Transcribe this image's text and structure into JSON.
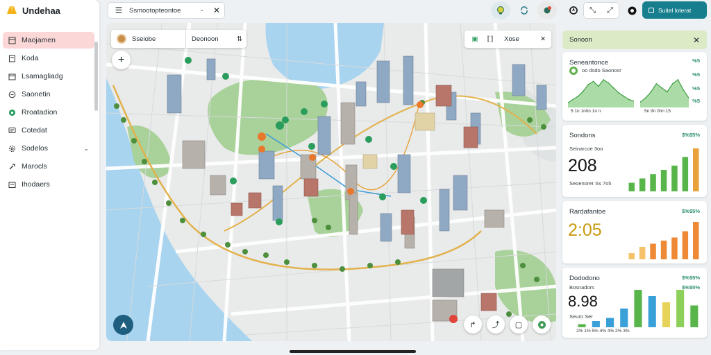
{
  "app": {
    "title": "Undehaa"
  },
  "sidebar": {
    "items": [
      {
        "label": "Maojamen",
        "icon": "grid-icon",
        "active": true
      },
      {
        "label": "Koda",
        "icon": "doc-icon"
      },
      {
        "label": "Lsamagliadg",
        "icon": "calendar-icon"
      },
      {
        "label": "Saonetin",
        "icon": "circle-icon"
      },
      {
        "label": "Rroatadion",
        "icon": "pin-icon"
      },
      {
        "label": "Cotedat",
        "icon": "chat-icon"
      },
      {
        "label": "Sodelos",
        "icon": "gear-icon",
        "chevron": "⌄"
      },
      {
        "label": "Marocls",
        "icon": "tool-icon"
      },
      {
        "label": "Ihodaers",
        "icon": "folder-icon"
      }
    ]
  },
  "topbar": {
    "search_value": "Ssmootopteontoe",
    "dash": "-",
    "primary_label": "Suitel loterat"
  },
  "map": {
    "route": {
      "from": "Sseiobe",
      "to": "Deonoon"
    },
    "tools": {
      "label": "Xose"
    }
  },
  "panel": {
    "title": "Sonoon",
    "cards": [
      {
        "title": "Seneantonce",
        "legend": "oo dsdo Saonosr",
        "tag_a": "%5",
        "tag_b": "%5",
        "tag_c": "%5",
        "tag_d": "%5",
        "xaxis": "5 1n 1n0n 1n n",
        "xaxis2": "5n 9n 0hn 15"
      },
      {
        "title": "Sondons",
        "tag": "$%$5%",
        "subtitle": "Seinarcoe 3oo",
        "value": "208",
        "foot": "Seoenorer Ss 7o5"
      },
      {
        "title": "Rardafantoe",
        "tag": "$%$5%",
        "value": "2:05"
      },
      {
        "title": "Dododono",
        "tag": "$%$5%",
        "value": "8.98",
        "sub_a": "Bosnadors",
        "sub_b": "Seuro Ser",
        "xaxis": "2% 1% 5% 4% 4% 2% 3%"
      }
    ]
  },
  "chart_data": [
    {
      "type": "area",
      "title": "Seneantonce",
      "x": [
        1,
        2,
        3,
        4,
        5,
        6,
        7,
        8,
        9,
        10,
        11,
        12,
        13,
        14
      ],
      "series": [
        {
          "values": [
            2,
            4,
            6,
            9,
            13,
            15,
            12,
            16,
            14,
            11,
            8,
            6,
            4,
            3
          ]
        }
      ]
    },
    {
      "type": "area",
      "x": [
        1,
        2,
        3,
        4,
        5,
        6,
        7,
        8,
        9,
        10
      ],
      "series": [
        {
          "values": [
            2,
            4,
            7,
            11,
            9,
            7,
            11,
            13,
            8,
            4
          ]
        }
      ]
    },
    {
      "type": "bar",
      "title": "Sondons",
      "categories": [
        "1",
        "2",
        "3",
        "4",
        "5",
        "6",
        "7"
      ],
      "values": [
        2,
        3,
        4,
        5,
        6,
        8,
        10
      ]
    },
    {
      "type": "bar",
      "title": "Rardafantoe",
      "categories": [
        "1",
        "2",
        "3",
        "4",
        "5",
        "6",
        "7"
      ],
      "values": [
        2,
        4,
        5,
        6,
        7,
        9,
        12
      ]
    },
    {
      "type": "bar",
      "title": "Dododono",
      "categories": [
        "1",
        "2",
        "3",
        "4",
        "5",
        "6",
        "7",
        "8",
        "9"
      ],
      "values": [
        1,
        2,
        3,
        6,
        12,
        10,
        8,
        12,
        7
      ]
    }
  ],
  "colors": {
    "accent": "#167e8c",
    "active_nav": "#fbd7d7",
    "green": "#58b54a",
    "orange": "#f08a2e"
  }
}
